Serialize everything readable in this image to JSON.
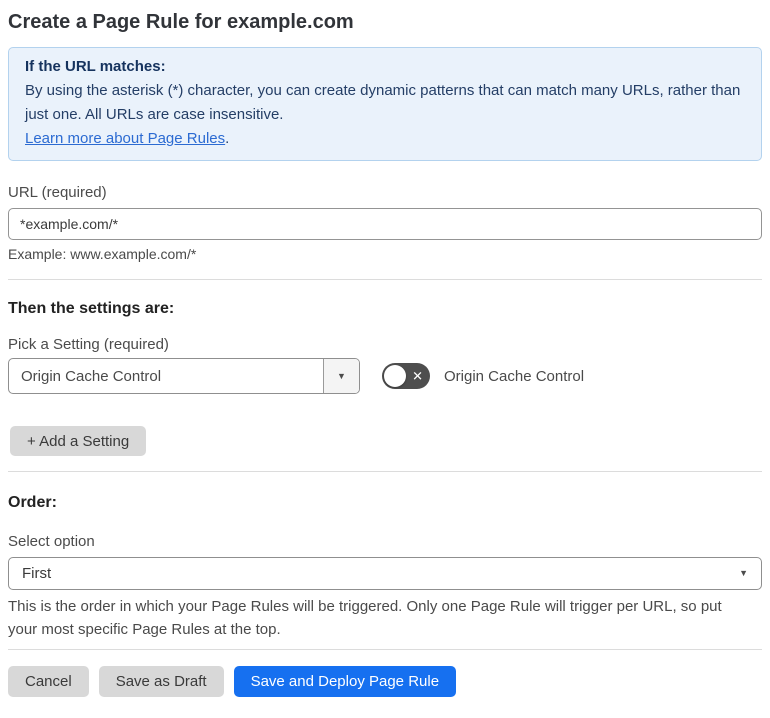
{
  "page": {
    "title": "Create a Page Rule for example.com"
  },
  "info_box": {
    "heading": "If the URL matches:",
    "body": "By using the asterisk (*) character, you can create dynamic patterns that can match many URLs, rather than just one. All URLs are case insensitive.",
    "link_text": "Learn more about Page Rules",
    "link_suffix": "."
  },
  "url_field": {
    "label": "URL (required)",
    "value": "*example.com/*",
    "example": "Example: www.example.com/*"
  },
  "settings_section": {
    "heading": "Then the settings are:",
    "picker_label": "Pick a Setting (required)",
    "selected_setting": "Origin Cache Control",
    "toggle": {
      "state": "off",
      "label": "Origin Cache Control"
    },
    "add_button_label": "+ Add a Setting"
  },
  "order_section": {
    "heading": "Order:",
    "label": "Select option",
    "selected_option": "First",
    "help": "This is the order in which your Page Rules will be triggered. Only one Page Rule will trigger per URL, so put your most specific Page Rules at the top."
  },
  "footer": {
    "cancel_label": "Cancel",
    "save_draft_label": "Save as Draft",
    "save_deploy_label": "Save and Deploy Page Rule"
  },
  "icons": {
    "dropdown_caret": "▼",
    "toggle_off_x": "✕"
  },
  "colors": {
    "info_box_bg": "#eaf2fb",
    "info_box_border": "#b3d2ee",
    "info_heading_text": "#16335e",
    "info_body_text": "#243e66",
    "link_blue": "#2c6bd2",
    "primary_button_blue": "#1670f0",
    "secondary_button_gray": "#d8d8d8",
    "toggle_off_bg": "#4e4e4e",
    "divider": "#dcdcdc"
  }
}
